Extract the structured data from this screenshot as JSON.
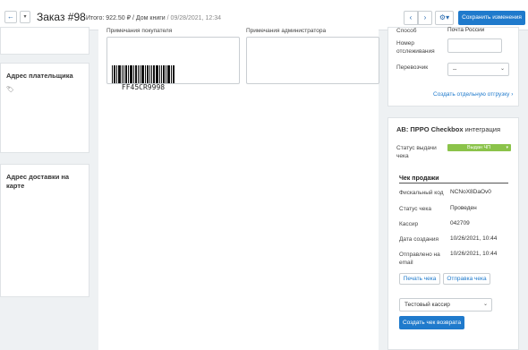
{
  "header": {
    "back_icon": "arrow-left-icon",
    "dropdown_icon": "caret-down-icon",
    "title": "Заказ #98",
    "total_label": "Итого:",
    "total_value": "922.50 ₽",
    "separator": "/",
    "store": "Дом книги",
    "date": "/ 09/28/2021, 12:34",
    "prev_icon": "chevron-left-icon",
    "next_icon": "chevron-right-icon",
    "settings_icon": "gear-icon",
    "save_label": "Сохранить изменения"
  },
  "left": {
    "payer_title": "Адрес плательщика",
    "tag_icon": "tag-icon",
    "delivery_title": "Адрес доставки на карте"
  },
  "main": {
    "customer_notes_label": "Примечания покупателя",
    "admin_notes_label": "Примечания администратора",
    "barcode_text": "FF45CR9998"
  },
  "shipping": {
    "method_label": "Способ",
    "method_value": "Почта России",
    "tracking_label": "Номер отслеживания",
    "carrier_label": "Перевозчик",
    "carrier_value": "--",
    "create_shipment_link": "Создать отдельную отгрузку ›"
  },
  "checkbox": {
    "title_prefix": "АВ: ПРРО ",
    "title_brand": "Checkbox",
    "title_suffix": " интеграция",
    "status_label": "Статус выдачи чека",
    "status_value": "Выдан ЧП",
    "receipt_header": "Чек продажи",
    "fiscal_code_label": "Фискальный код",
    "fiscal_code_value": "NCNoX8DaOv0",
    "receipt_status_label": "Статус чека",
    "receipt_status_value": "Проведен",
    "cashier_label": "Кассир",
    "cashier_value": "042709",
    "created_label": "Дата создания",
    "created_value": "10/26/2021, 10:44",
    "emailed_label": "Отправлено на email",
    "emailed_value": "10/26/2021, 10:44",
    "print_button": "Печать чека",
    "send_button": "Отправка чека",
    "cashier_select_value": "Тестовый кассир",
    "create_return_button": "Создать чек возврата",
    "accent_color": "#1f7acc",
    "status_color": "#8bc34a"
  }
}
